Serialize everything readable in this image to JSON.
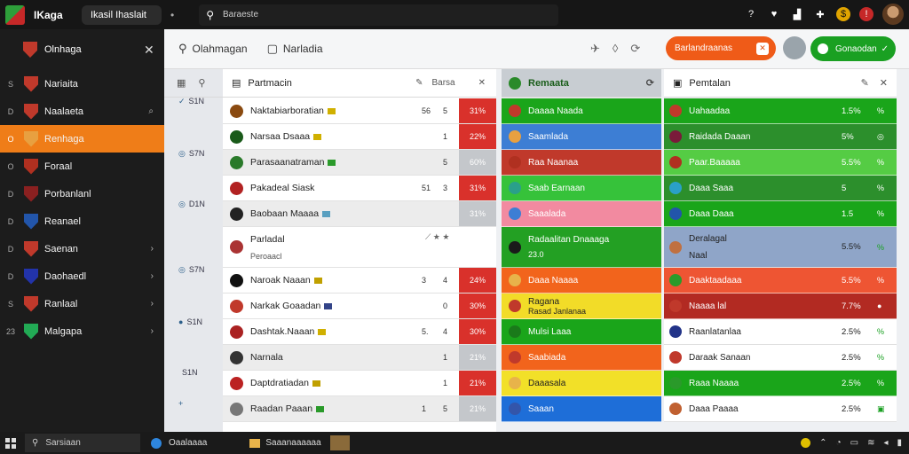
{
  "topbar": {
    "app_name": "IKaga",
    "window_title": "Ikasil Ihaslait",
    "menu_dot": "•",
    "search_text": "Baraeste"
  },
  "sidebar": {
    "title": "Olnhaga",
    "items": [
      {
        "num": "S",
        "label": "Nariaita",
        "color": "#c0392b",
        "chev": ""
      },
      {
        "num": "D",
        "label": "Naalaeta",
        "color": "#c0392b",
        "chev": "⌕"
      },
      {
        "num": "O",
        "label": "Renhaga",
        "color": "#e8a040",
        "chev": "",
        "active": true
      },
      {
        "num": "O",
        "label": "Foraal",
        "color": "#b03020",
        "chev": ""
      },
      {
        "num": "D",
        "label": "Porbanlanl",
        "color": "#8a2020",
        "chev": ""
      },
      {
        "num": "D",
        "label": "Reanael",
        "color": "#2255aa",
        "chev": ""
      },
      {
        "num": "D",
        "label": "Saenan",
        "color": "#c0392b",
        "chev": "›"
      },
      {
        "num": "D",
        "label": "Daohaedl",
        "color": "#2233aa",
        "chev": "›"
      },
      {
        "num": "S",
        "label": "Ranlaal",
        "color": "#c0392b",
        "chev": "›"
      },
      {
        "num": "23",
        "label": "Malgapa",
        "color": "#22aa55",
        "chev": "›"
      }
    ]
  },
  "filterbar": {
    "left_label": "Olahmagan",
    "right_label": "Narladia",
    "btn_orange": "Barlandraanas",
    "btn_green": "Gonaodan"
  },
  "gutter": {
    "rows": [
      {
        "mark": "✓",
        "val": "S1N"
      },
      {
        "mark": "◎",
        "val": "S7N"
      },
      {
        "mark": "◎",
        "val": "D1N"
      },
      {
        "mark": "◎",
        "val": "S7N"
      },
      {
        "mark": "●",
        "val": "S1N"
      },
      {
        "mark": "",
        "val": "S1N"
      },
      {
        "mark": "+",
        "val": ""
      }
    ]
  },
  "center": {
    "title": "Partmacin",
    "tool_label": "Barsa",
    "rows": [
      {
        "team": "Naktabiarboratian",
        "n1": "56",
        "n2": "5",
        "pct": "31%",
        "gray": false
      },
      {
        "team": "Narsaa Dsaaa",
        "n1": "",
        "n2": "1",
        "pct": "22%",
        "gray": false
      },
      {
        "team": "Parasaanatraman",
        "n1": "",
        "n2": "5",
        "pct": "60%",
        "gray": true
      },
      {
        "team": "Pakadeal Siask",
        "n1": "51",
        "n2": "3",
        "pct": "31%",
        "gray": false
      },
      {
        "team": "Baobaan Maaaa",
        "n1": "",
        "n2": "",
        "pct": "31%",
        "gray": true
      },
      {
        "team": "Parladal",
        "sub": "Peroaacl",
        "n1": "",
        "n2": "",
        "pct": "",
        "gray": false
      },
      {
        "team": "Naroak Naaan",
        "n1": "3",
        "n2": "4",
        "pct": "24%",
        "gray": false
      },
      {
        "team": "Narkak Goaadan",
        "n1": "",
        "n2": "0",
        "pct": "30%",
        "gray": false
      },
      {
        "team": "Dashtak.Naaan",
        "n1": "5.",
        "n2": "4",
        "pct": "30%",
        "gray": false
      },
      {
        "team": "Narnala",
        "n1": "",
        "n2": "1",
        "pct": "21%",
        "gray": true
      },
      {
        "team": "Daptdratiadan",
        "n1": "",
        "n2": "1",
        "pct": "21%",
        "gray": false
      },
      {
        "team": "Raadan Paaan",
        "n1": "1",
        "n2": "5",
        "pct": "21%",
        "gray": true
      }
    ]
  },
  "middle": {
    "title": "Remaata",
    "rows": [
      {
        "team": "Daaaa Naada",
        "color": "#1aa51a"
      },
      {
        "team": "Saamlada",
        "color": "#3d7ed4"
      },
      {
        "team": "Raa Naanaa",
        "color": "#c0392b"
      },
      {
        "team": "Saab Earnaan",
        "color": "#36c23a"
      },
      {
        "team": "Saaalada",
        "color": "#f28aa0"
      },
      {
        "team": "Radaalitan Dnaaaga",
        "sub": "23.0",
        "color": "#23a023"
      },
      {
        "team": "Daaa Naaaa",
        "color": "#f2641c"
      },
      {
        "team": "Ragana",
        "sub": "Rasad Janlanaa",
        "color": "#f2dc28",
        "dark": true
      },
      {
        "team": "Mulsi Laaa",
        "color": "#1aa51a"
      },
      {
        "team": "Saabiada",
        "color": "#f2641c"
      },
      {
        "team": "Daaasala",
        "color": "#f2e028",
        "dark": true
      },
      {
        "team": "Saaan",
        "color": "#1e6ed8"
      }
    ]
  },
  "right": {
    "title": "Pemtalan",
    "rows": [
      {
        "team": "Uahaadaa",
        "val": "1.5%",
        "ind": "%",
        "color": "#1aa51a"
      },
      {
        "team": "Raidada Daaan",
        "val": "5%",
        "ind": "◎",
        "color": "#2c8f2c"
      },
      {
        "team": "Paar.Baaaaa",
        "val": "5.5%",
        "ind": "%",
        "color": "#55cc44"
      },
      {
        "team": "Daaa Saaa",
        "val": "5",
        "ind": "%",
        "color": "#2c8f2c"
      },
      {
        "team": "Daaa Daaa",
        "val": "1.5",
        "ind": "%",
        "color": "#1aa51a"
      },
      {
        "team": "Deralagal",
        "sub": "Naal",
        "val": "5.5%",
        "ind": "%",
        "color": "#8fa5c8",
        "dark": true
      },
      {
        "team": "Daaktaadaaa",
        "val": "5.5%",
        "ind": "%",
        "color": "#ee5533"
      },
      {
        "team": "Naaaa lal",
        "val": "7.7%",
        "ind": "●",
        "color": "#b22a22"
      },
      {
        "team": "Raanlatanlaa",
        "val": "2.5%",
        "ind": "%",
        "color": "#ffffff",
        "dark": true
      },
      {
        "team": "Daraak Sanaan",
        "val": "2.5%",
        "ind": "%",
        "color": "#ffffff",
        "dark": true
      },
      {
        "team": "Raaa Naaaa",
        "val": "2.5%",
        "ind": "%",
        "color": "#1aa51a"
      },
      {
        "team": "Daaa Paaaa",
        "val": "2.5%",
        "ind": "▣",
        "color": "#ffffff",
        "dark": true
      }
    ]
  },
  "taskbar": {
    "search": "Sarsiaan",
    "app1": "Oaalaaaa",
    "app2": "Saaanaaaaaa"
  },
  "colors": {
    "accent_orange": "#ef7d18",
    "accent_green": "#1aa022",
    "pct_red": "#d9312b",
    "pct_gray": "#c4c7cb"
  }
}
